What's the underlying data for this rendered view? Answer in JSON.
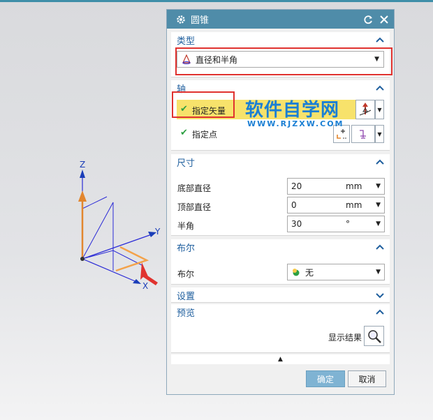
{
  "dialog": {
    "title": "圆锥",
    "sections": {
      "type": {
        "label": "类型",
        "value": "直径和半角"
      },
      "axis": {
        "label": "轴",
        "specify_vector": "指定矢量",
        "specify_point": "指定点"
      },
      "dimensions": {
        "label": "尺寸",
        "rows": [
          {
            "label": "底部直径",
            "value": "20",
            "unit": "mm"
          },
          {
            "label": "顶部直径",
            "value": "0",
            "unit": "mm"
          },
          {
            "label": "半角",
            "value": "30",
            "unit": "°"
          }
        ]
      },
      "boolean": {
        "label": "布尔",
        "row_label": "布尔",
        "value": "无"
      },
      "settings": {
        "label": "设置"
      },
      "preview": {
        "label": "预览",
        "show_result": "显示结果"
      }
    },
    "buttons": {
      "ok": "确定",
      "cancel": "取消"
    }
  },
  "watermark": {
    "title": "软件自学网",
    "url": "WWW.RJZXW.COM"
  },
  "axes": {
    "x": "X",
    "y": "Y",
    "z": "Z"
  },
  "colors": {
    "accent": "#4f8ca9",
    "section_text": "#1f5f9e",
    "highlight": "#f7e26b",
    "ok_button": "#7fb3d3",
    "red_mark": "#e0322f"
  }
}
